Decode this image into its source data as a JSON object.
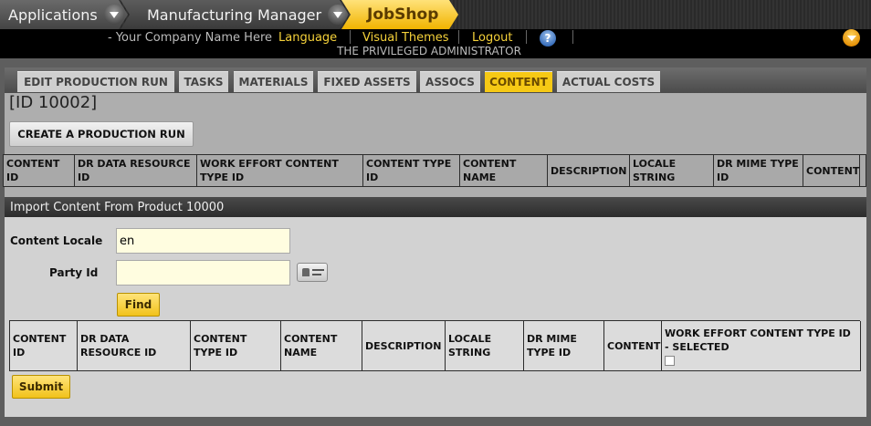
{
  "appbar": {
    "applications": "Applications",
    "manager": "Manufacturing Manager",
    "current_app": "JobShop"
  },
  "header": {
    "company": "- Your Company Name Here",
    "language": "Language",
    "visual_themes": "Visual Themes",
    "logout": "Logout",
    "help_glyph": "?",
    "user": "THE PRIVILEGED ADMINISTRATOR"
  },
  "tabs": [
    {
      "label": "EDIT PRODUCTION RUN",
      "active": false
    },
    {
      "label": "TASKS",
      "active": false
    },
    {
      "label": "MATERIALS",
      "active": false
    },
    {
      "label": "FIXED ASSETS",
      "active": false
    },
    {
      "label": "ASSOCS",
      "active": false
    },
    {
      "label": "CONTENT",
      "active": true
    },
    {
      "label": "ACTUAL COSTS",
      "active": false
    }
  ],
  "page": {
    "id_title": "[ID 10002]",
    "create_button": "CREATE A PRODUCTION RUN"
  },
  "content_table": {
    "headers": [
      "CONTENT ID",
      "DR DATA RESOURCE ID",
      "WORK EFFORT CONTENT TYPE ID",
      "CONTENT TYPE ID",
      "CONTENT NAME",
      "DESCRIPTION",
      "LOCALE STRING",
      "DR MIME TYPE ID",
      "CONTENT"
    ]
  },
  "import_panel": {
    "title": "Import Content From Product 10000",
    "locale_label": "Content Locale",
    "locale_value": "en",
    "party_label": "Party Id",
    "party_value": "",
    "find_button": "Find",
    "headers": [
      "CONTENT ID",
      "DR DATA RESOURCE ID",
      "CONTENT TYPE ID",
      "CONTENT NAME",
      "DESCRIPTION",
      "LOCALE STRING",
      "DR MIME TYPE ID",
      "CONTENT",
      "WORK EFFORT CONTENT TYPE ID - SELECTED"
    ],
    "submit_button": "Submit"
  },
  "colors": {
    "accent": "#f6c915",
    "header_bg": "#000000",
    "panel_bg": "#d2d2d2"
  }
}
